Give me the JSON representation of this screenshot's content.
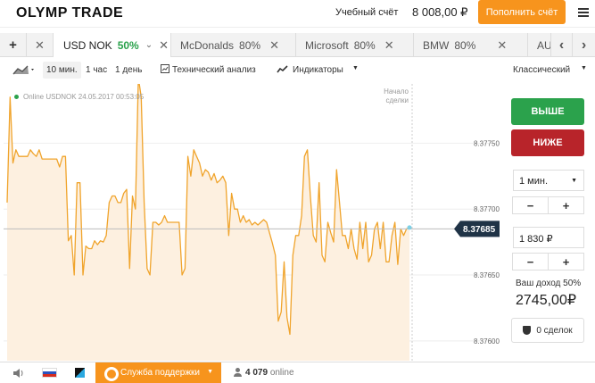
{
  "header": {
    "logo": "OLYMP TRADE",
    "account_label": "Учебный счёт",
    "balance": "8 008,00 ₽",
    "deposit_button": "Пополнить счёт"
  },
  "tabs": {
    "add": "+",
    "items": [
      {
        "name": "USD NOK",
        "pct": "50%",
        "active": true
      },
      {
        "name": "McDonalds",
        "pct": "80%"
      },
      {
        "name": "Microsoft",
        "pct": "80%"
      },
      {
        "name": "BMW",
        "pct": "80%"
      },
      {
        "name": "AU",
        "pct": ""
      }
    ]
  },
  "toolbar": {
    "tf1": "10 мин.",
    "tf2": "1 час",
    "tf3": "1 день",
    "tech": "Технический анализ",
    "indicators": "Индикаторы",
    "view": "Классический"
  },
  "chart": {
    "status": "Online USDNOK 24.05.2017 00:53:05",
    "start_label_1": "Начало",
    "start_label_2": "сделки",
    "current_price": "8.37685",
    "ticks": [
      "8.37750",
      "8.37700",
      "8.37650",
      "8.37600"
    ],
    "colors": {
      "line": "#f0a42c",
      "fill": "#fdf0e0",
      "price_tag": "#1f3346"
    }
  },
  "chart_data": {
    "type": "area",
    "title": "",
    "xlabel": "",
    "ylabel": "",
    "ylim": [
      8.37585,
      8.37795
    ],
    "current": 8.37685,
    "series": [
      {
        "name": "USDNOK",
        "values": [
          8.37705,
          8.37785,
          8.37735,
          8.37745,
          8.3774,
          8.3774,
          8.3774,
          8.3774,
          8.37745,
          8.37742,
          8.3774,
          8.37745,
          8.37738,
          8.37738,
          8.37738,
          8.37738,
          8.37738,
          8.37738,
          8.37732,
          8.3774,
          8.3774,
          8.37676,
          8.3768,
          8.3765,
          8.3772,
          8.3772,
          8.3765,
          8.37672,
          8.3767,
          8.3767,
          8.37676,
          8.37673,
          8.37676,
          8.37675,
          8.3768,
          8.37705,
          8.3771,
          8.3771,
          8.37705,
          8.37705,
          8.37712,
          8.37715,
          8.37655,
          8.3771,
          8.377,
          8.378,
          8.37785,
          8.37705,
          8.37655,
          8.3765,
          8.3769,
          8.3769,
          8.37688,
          8.3769,
          8.37695,
          8.3769,
          8.3769,
          8.3769,
          8.3769,
          8.3769,
          8.3765,
          8.37655,
          8.3774,
          8.37725,
          8.37745,
          8.3774,
          8.37735,
          8.37725,
          8.3773,
          8.37728,
          8.37722,
          8.37727,
          8.3772,
          8.37722,
          8.37725,
          8.3772,
          8.3768,
          8.37712,
          8.377,
          8.377,
          8.3769,
          8.37695,
          8.3769,
          8.37692,
          8.37688,
          8.3769,
          8.37688,
          8.3769,
          8.37692,
          8.3769,
          8.37682,
          8.37674,
          8.37665,
          8.37615,
          8.37622,
          8.3766,
          8.37618,
          8.37605,
          8.37665,
          8.3768,
          8.3768,
          8.37695,
          8.3774,
          8.37745,
          8.3771,
          8.3768,
          8.37675,
          8.3772,
          8.37665,
          8.3766,
          8.3769,
          8.37682,
          8.37675,
          8.3773,
          8.37705,
          8.3768,
          8.3768,
          8.3767,
          8.37685,
          8.3767,
          8.37662,
          8.3769,
          8.3767,
          8.3769,
          8.3766,
          8.37665,
          8.37685,
          8.3769,
          8.3767,
          8.3769,
          8.3766,
          8.3766,
          8.3768,
          8.3769,
          8.37658,
          8.37685,
          8.3768,
          8.37685,
          8.37686
        ]
      }
    ]
  },
  "panel": {
    "up": "ВЫШЕ",
    "down": "НИЖЕ",
    "time": "1 мин.",
    "amount": "1 830 ₽",
    "minus": "−",
    "plus": "+",
    "income_label": "Ваш доход 50%",
    "income_value": "2745,00₽",
    "deals": "0 сделок"
  },
  "footer": {
    "support": "Служба поддержки",
    "online_count": "4 079",
    "online_label": "online"
  }
}
